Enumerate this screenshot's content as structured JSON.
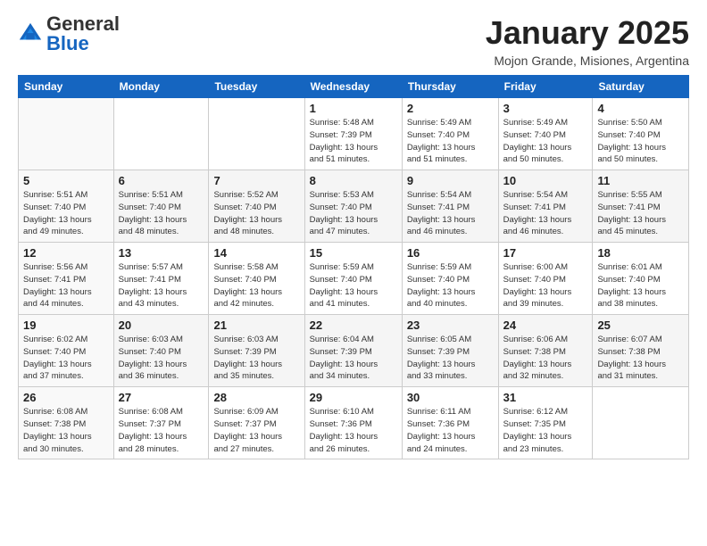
{
  "logo": {
    "general": "General",
    "blue": "Blue"
  },
  "header": {
    "month": "January 2025",
    "location": "Mojon Grande, Misiones, Argentina"
  },
  "days_of_week": [
    "Sunday",
    "Monday",
    "Tuesday",
    "Wednesday",
    "Thursday",
    "Friday",
    "Saturday"
  ],
  "weeks": [
    [
      {
        "day": "",
        "info": ""
      },
      {
        "day": "",
        "info": ""
      },
      {
        "day": "",
        "info": ""
      },
      {
        "day": "1",
        "info": "Sunrise: 5:48 AM\nSunset: 7:39 PM\nDaylight: 13 hours\nand 51 minutes."
      },
      {
        "day": "2",
        "info": "Sunrise: 5:49 AM\nSunset: 7:40 PM\nDaylight: 13 hours\nand 51 minutes."
      },
      {
        "day": "3",
        "info": "Sunrise: 5:49 AM\nSunset: 7:40 PM\nDaylight: 13 hours\nand 50 minutes."
      },
      {
        "day": "4",
        "info": "Sunrise: 5:50 AM\nSunset: 7:40 PM\nDaylight: 13 hours\nand 50 minutes."
      }
    ],
    [
      {
        "day": "5",
        "info": "Sunrise: 5:51 AM\nSunset: 7:40 PM\nDaylight: 13 hours\nand 49 minutes."
      },
      {
        "day": "6",
        "info": "Sunrise: 5:51 AM\nSunset: 7:40 PM\nDaylight: 13 hours\nand 48 minutes."
      },
      {
        "day": "7",
        "info": "Sunrise: 5:52 AM\nSunset: 7:40 PM\nDaylight: 13 hours\nand 48 minutes."
      },
      {
        "day": "8",
        "info": "Sunrise: 5:53 AM\nSunset: 7:40 PM\nDaylight: 13 hours\nand 47 minutes."
      },
      {
        "day": "9",
        "info": "Sunrise: 5:54 AM\nSunset: 7:41 PM\nDaylight: 13 hours\nand 46 minutes."
      },
      {
        "day": "10",
        "info": "Sunrise: 5:54 AM\nSunset: 7:41 PM\nDaylight: 13 hours\nand 46 minutes."
      },
      {
        "day": "11",
        "info": "Sunrise: 5:55 AM\nSunset: 7:41 PM\nDaylight: 13 hours\nand 45 minutes."
      }
    ],
    [
      {
        "day": "12",
        "info": "Sunrise: 5:56 AM\nSunset: 7:41 PM\nDaylight: 13 hours\nand 44 minutes."
      },
      {
        "day": "13",
        "info": "Sunrise: 5:57 AM\nSunset: 7:41 PM\nDaylight: 13 hours\nand 43 minutes."
      },
      {
        "day": "14",
        "info": "Sunrise: 5:58 AM\nSunset: 7:40 PM\nDaylight: 13 hours\nand 42 minutes."
      },
      {
        "day": "15",
        "info": "Sunrise: 5:59 AM\nSunset: 7:40 PM\nDaylight: 13 hours\nand 41 minutes."
      },
      {
        "day": "16",
        "info": "Sunrise: 5:59 AM\nSunset: 7:40 PM\nDaylight: 13 hours\nand 40 minutes."
      },
      {
        "day": "17",
        "info": "Sunrise: 6:00 AM\nSunset: 7:40 PM\nDaylight: 13 hours\nand 39 minutes."
      },
      {
        "day": "18",
        "info": "Sunrise: 6:01 AM\nSunset: 7:40 PM\nDaylight: 13 hours\nand 38 minutes."
      }
    ],
    [
      {
        "day": "19",
        "info": "Sunrise: 6:02 AM\nSunset: 7:40 PM\nDaylight: 13 hours\nand 37 minutes."
      },
      {
        "day": "20",
        "info": "Sunrise: 6:03 AM\nSunset: 7:40 PM\nDaylight: 13 hours\nand 36 minutes."
      },
      {
        "day": "21",
        "info": "Sunrise: 6:03 AM\nSunset: 7:39 PM\nDaylight: 13 hours\nand 35 minutes."
      },
      {
        "day": "22",
        "info": "Sunrise: 6:04 AM\nSunset: 7:39 PM\nDaylight: 13 hours\nand 34 minutes."
      },
      {
        "day": "23",
        "info": "Sunrise: 6:05 AM\nSunset: 7:39 PM\nDaylight: 13 hours\nand 33 minutes."
      },
      {
        "day": "24",
        "info": "Sunrise: 6:06 AM\nSunset: 7:38 PM\nDaylight: 13 hours\nand 32 minutes."
      },
      {
        "day": "25",
        "info": "Sunrise: 6:07 AM\nSunset: 7:38 PM\nDaylight: 13 hours\nand 31 minutes."
      }
    ],
    [
      {
        "day": "26",
        "info": "Sunrise: 6:08 AM\nSunset: 7:38 PM\nDaylight: 13 hours\nand 30 minutes."
      },
      {
        "day": "27",
        "info": "Sunrise: 6:08 AM\nSunset: 7:37 PM\nDaylight: 13 hours\nand 28 minutes."
      },
      {
        "day": "28",
        "info": "Sunrise: 6:09 AM\nSunset: 7:37 PM\nDaylight: 13 hours\nand 27 minutes."
      },
      {
        "day": "29",
        "info": "Sunrise: 6:10 AM\nSunset: 7:36 PM\nDaylight: 13 hours\nand 26 minutes."
      },
      {
        "day": "30",
        "info": "Sunrise: 6:11 AM\nSunset: 7:36 PM\nDaylight: 13 hours\nand 24 minutes."
      },
      {
        "day": "31",
        "info": "Sunrise: 6:12 AM\nSunset: 7:35 PM\nDaylight: 13 hours\nand 23 minutes."
      },
      {
        "day": "",
        "info": ""
      }
    ]
  ]
}
